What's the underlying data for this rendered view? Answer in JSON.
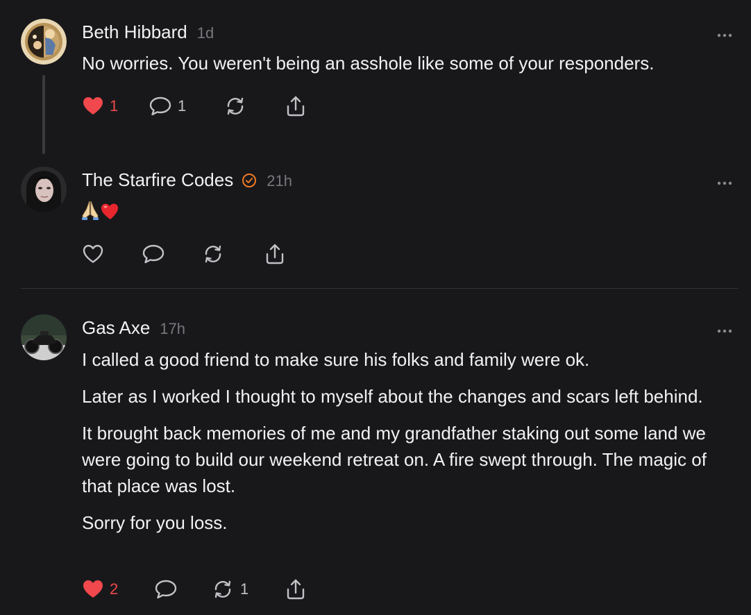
{
  "posts": [
    {
      "author": "Beth Hibbard",
      "time": "1d",
      "text": "No worries. You weren't being an asshole like some of your responders.",
      "likes": "1",
      "replies": "1",
      "liked": true
    },
    {
      "author": "The Starfire Codes",
      "time": "21h",
      "verified": true,
      "emojis": [
        "folded-hands",
        "red-heart"
      ]
    },
    {
      "author": "Gas Axe",
      "time": "17h",
      "paragraphs": [
        "I called a good friend to make sure his folks and family were ok.",
        "Later as I worked I thought to myself about the changes and scars left behind.",
        "It brought back memories of me and my grandfather staking out some land we were going to build our weekend retreat on. A fire swept through. The magic of that place was lost.",
        "Sorry for you loss."
      ],
      "likes": "2",
      "reposts": "1",
      "liked": true
    }
  ],
  "colors": {
    "background": "#18181b",
    "text": "#f2f2f4",
    "muted": "#77777c",
    "like_red": "#f0484c",
    "verified_orange": "#f07a24"
  }
}
